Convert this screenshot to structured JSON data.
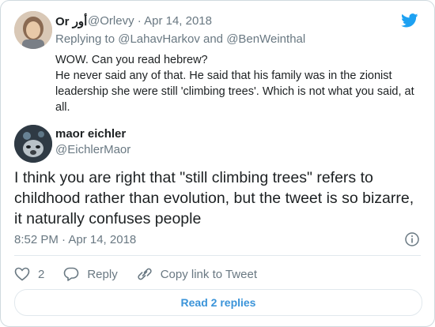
{
  "tweet1": {
    "name": "Or أور",
    "handle": "@Orlevy",
    "date": "Apr 14, 2018",
    "replying_prefix": "Replying to",
    "reply_user1": "@LahavHarkov",
    "reply_and": "and",
    "reply_user2": "@BenWeinthal",
    "text_line1": "WOW. Can you read hebrew?",
    "text_line2": "He never said any of that. He said that his family was in the zionist leadership she were still 'climbing trees'. Which is not what you said, at all."
  },
  "tweet2": {
    "name": "maor eichler",
    "handle": "@EichlerMaor",
    "text": "I think you are right that \"still climbing trees\" refers to childhood rather than evolution, but the tweet is so bizarre, it naturally confuses people",
    "timestamp": "8:52 PM · Apr 14, 2018"
  },
  "actions": {
    "like_count": "2",
    "reply_label": "Reply",
    "copy_link_label": "Copy link to Tweet"
  },
  "read_replies_label": "Read 2 replies",
  "colors": {
    "brand_blue": "#1da1f2",
    "link_blue": "#3b94d9",
    "muted": "#697882",
    "border": "#e1e8ed"
  },
  "icons": [
    "twitter-bird-icon",
    "info-icon",
    "heart-icon",
    "reply-icon",
    "link-icon"
  ]
}
